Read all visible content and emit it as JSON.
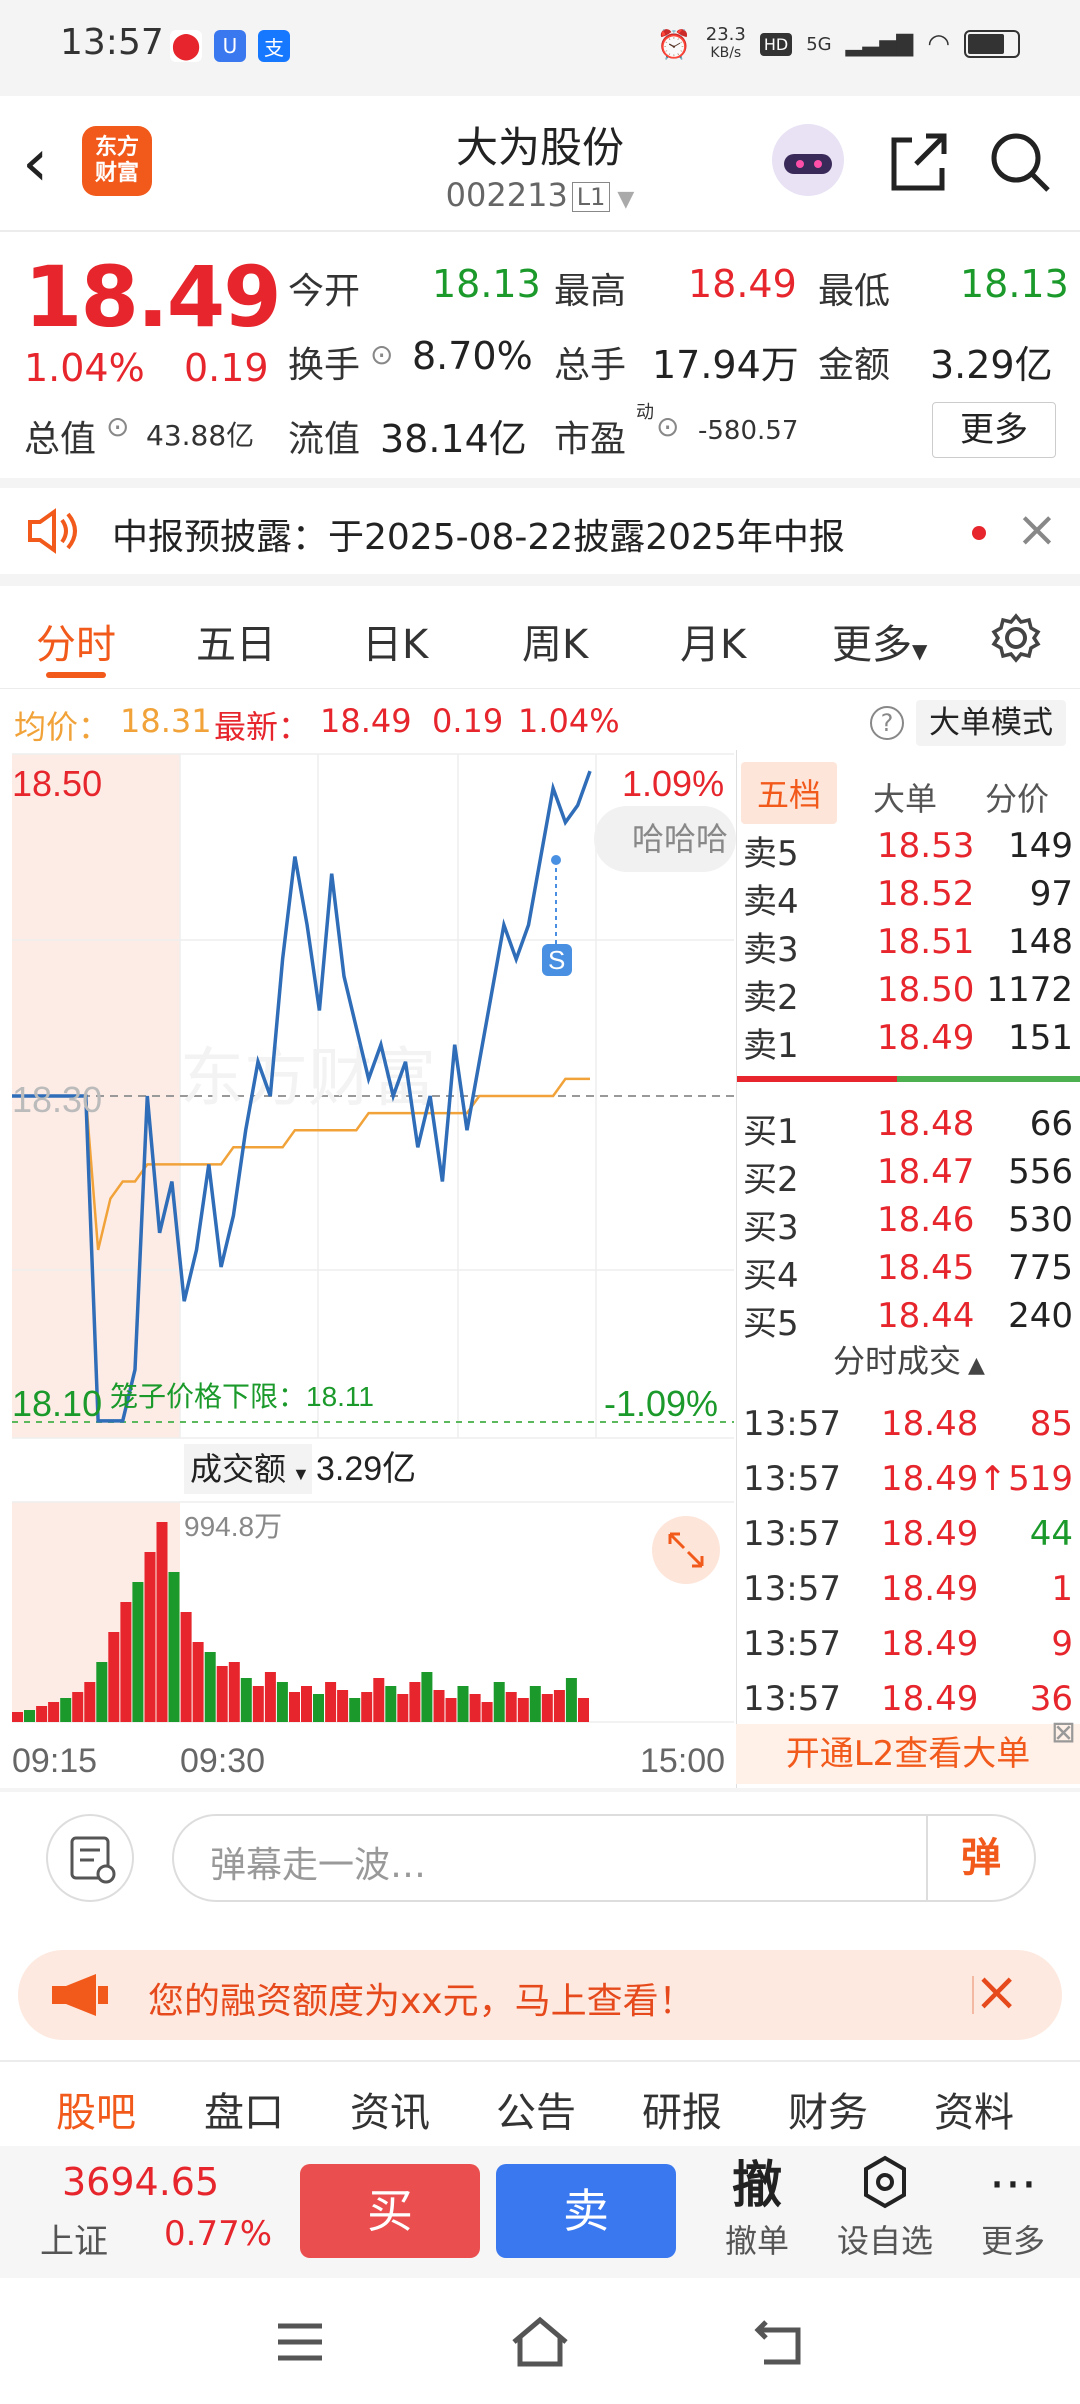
{
  "status_bar": {
    "time": "13:57",
    "net_speed": "23.3\nKB/s",
    "net_speed_top": "23.3",
    "net_speed_unit": "KB/s",
    "hd": "HD",
    "signal": "5G"
  },
  "header": {
    "back_icon": "back-arrow-icon",
    "logo_top": "东方",
    "logo_bottom": "财富",
    "title": "大为股份",
    "code": "002213",
    "level": "L1"
  },
  "quote": {
    "price": "18.49",
    "change_pct": "1.04%",
    "change": "0.19",
    "open_label": "今开",
    "open": "18.13",
    "high_label": "最高",
    "high": "18.49",
    "low_label": "最低",
    "low": "18.13",
    "turnover_label": "换手",
    "turnover": "8.70%",
    "volume_label": "总手",
    "volume": "17.94万",
    "amount_label": "金额",
    "amount": "3.29亿",
    "mktcap_label": "总值",
    "mktcap": "43.88亿",
    "float_label": "流值",
    "float_cap": "38.14亿",
    "pe_label": "市盈",
    "pe_sup": "动",
    "pe": "-580.57",
    "more_label": "更多"
  },
  "notice": {
    "text": "中报预披露：于2025-08-22披露2025年中报"
  },
  "tabs": [
    "分时",
    "五日",
    "日K",
    "周K",
    "月K",
    "更多"
  ],
  "avg_bar": {
    "avg_label": "均价：",
    "avg": "18.31",
    "latest_label": "最新：",
    "latest": "18.49",
    "change": "0.19",
    "pct": "1.04%",
    "mode_btn": "大单模式"
  },
  "chart_labels": {
    "top_price": "18.50",
    "mid_price": "18.30",
    "low_price": "18.10",
    "top_pct": "1.09%",
    "low_pct": "-1.09%",
    "cage_limit": "笼子价格下限：18.11",
    "danmu_bubble": "哈哈哈",
    "s_marker": "S",
    "vol_label": "成交额",
    "vol_value": "3.29亿",
    "vol_max": "994.8万",
    "t_start": "09:15",
    "t_open": "09:30",
    "t_end": "15:00",
    "watermark": "东方财富"
  },
  "chart_data": {
    "type": "line",
    "title": "",
    "ylim": [
      18.1,
      18.5
    ],
    "series": [
      {
        "values": [
          18.3,
          18.3,
          18.3,
          18.3,
          18.3,
          18.3,
          18.3,
          18.11,
          18.11,
          18.11,
          18.14,
          18.3,
          18.22,
          18.25,
          18.18,
          18.21,
          18.26,
          18.2,
          18.23,
          18.28,
          18.32,
          18.3,
          18.38,
          18.44,
          18.4,
          18.35,
          18.43,
          18.37,
          18.34,
          18.31,
          18.33,
          18.3,
          18.32,
          18.27,
          18.3,
          18.25,
          18.33,
          18.28,
          18.32,
          18.36,
          18.4,
          18.38,
          18.4,
          18.44,
          18.48,
          18.46,
          18.47,
          18.49
        ]
      },
      {
        "values": [
          18.3,
          18.3,
          18.3,
          18.3,
          18.3,
          18.3,
          18.3,
          18.21,
          18.24,
          18.25,
          18.25,
          18.26,
          18.26,
          18.26,
          18.26,
          18.26,
          18.26,
          18.26,
          18.27,
          18.27,
          18.27,
          18.27,
          18.27,
          18.28,
          18.28,
          18.28,
          18.28,
          18.28,
          18.28,
          18.29,
          18.29,
          18.29,
          18.29,
          18.29,
          18.29,
          18.29,
          18.29,
          18.29,
          18.3,
          18.3,
          18.3,
          18.3,
          18.3,
          18.3,
          18.3,
          18.31,
          18.31,
          18.31
        ]
      }
    ],
    "volume": [
      5,
      6,
      8,
      10,
      12,
      15,
      20,
      30,
      45,
      60,
      70,
      85,
      100,
      75,
      55,
      40,
      35,
      28,
      30,
      22,
      18,
      25,
      20,
      15,
      18,
      14,
      20,
      16,
      12,
      15,
      22,
      18,
      14,
      20,
      25,
      16,
      12,
      18,
      14,
      10,
      20,
      15,
      12,
      18,
      14,
      16,
      22,
      12
    ]
  },
  "order_book": {
    "headers": [
      "五档",
      "大单",
      "分价"
    ],
    "asks": [
      [
        "卖5",
        "18.53",
        "149"
      ],
      [
        "卖4",
        "18.52",
        "97"
      ],
      [
        "卖3",
        "18.51",
        "148"
      ],
      [
        "卖2",
        "18.50",
        "1172"
      ],
      [
        "卖1",
        "18.49",
        "151"
      ]
    ],
    "bids": [
      [
        "买1",
        "18.48",
        "66"
      ],
      [
        "买2",
        "18.47",
        "556"
      ],
      [
        "买3",
        "18.46",
        "530"
      ],
      [
        "买4",
        "18.45",
        "775"
      ],
      [
        "买5",
        "18.44",
        "240"
      ]
    ],
    "trades_title": "分时成交",
    "trades": [
      [
        "13:57",
        "18.48",
        "85"
      ],
      [
        "13:57",
        "18.49↑",
        "519"
      ],
      [
        "13:57",
        "18.49",
        "44"
      ],
      [
        "13:57",
        "18.49",
        "1"
      ],
      [
        "13:57",
        "18.49",
        "9"
      ],
      [
        "13:57",
        "18.49",
        "36"
      ]
    ],
    "l2_label": "开通L2查看大单"
  },
  "danmu": {
    "placeholder": "弹幕走一波…",
    "send": "弹"
  },
  "banner": {
    "text": "您的融资额度为xx元，马上查看！"
  },
  "footer_tabs": [
    "股吧",
    "盘口",
    "资讯",
    "公告",
    "研报",
    "财务",
    "资料"
  ],
  "bottom": {
    "index_value": "3694.65",
    "index_name": "上证",
    "index_pct": "0.77%",
    "buy": "买",
    "sell": "卖",
    "cancel_glyph": "撤",
    "cancel": "撤单",
    "watch": "设自选",
    "more": "更多"
  }
}
